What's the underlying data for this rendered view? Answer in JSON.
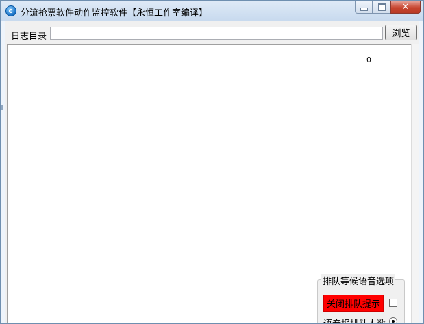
{
  "window": {
    "title": "分流抢票软件动作监控软件【永恒工作室编译】",
    "icon": "app-icon",
    "controls": [
      "minimize-icon",
      "maximize-icon",
      "close-icon"
    ]
  },
  "toolbar": {
    "log_dir_label": "日志目录",
    "log_dir_value": "",
    "browse_label": "浏览"
  },
  "log": {
    "counter": "0"
  },
  "queue_options": {
    "group_title": "排队等候语音选项",
    "close_prompt_label": "关闭排队提示",
    "close_prompt_checked": false,
    "voice_count_label": "语音报排队人数",
    "voice_count_selected": true,
    "alert_color": "#ff0000"
  }
}
